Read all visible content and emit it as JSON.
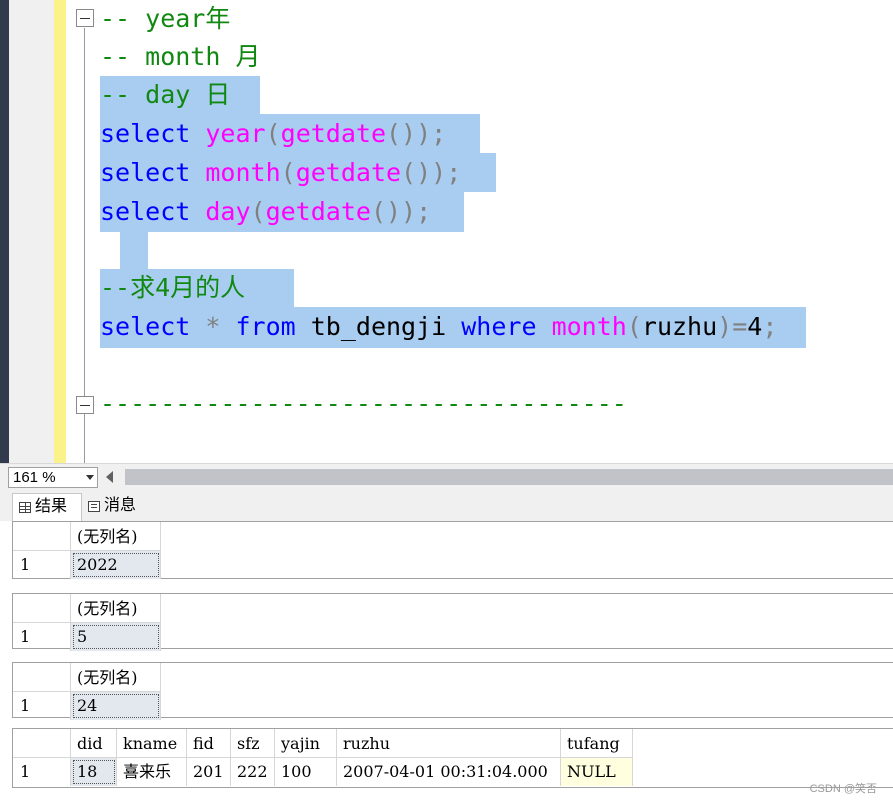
{
  "editor": {
    "lines": [
      {
        "tokens": [
          {
            "t": "-- year年",
            "c": "cm"
          }
        ]
      },
      {
        "tokens": [
          {
            "t": "-- month 月",
            "c": "cm"
          }
        ]
      },
      {
        "tokens": [
          {
            "t": "-- day 日",
            "c": "cm"
          }
        ]
      },
      {
        "tokens": [
          {
            "t": "select ",
            "c": "kw"
          },
          {
            "t": "year",
            "c": "fn"
          },
          {
            "t": "(",
            "c": "pn"
          },
          {
            "t": "getdate",
            "c": "fn"
          },
          {
            "t": "());",
            "c": "pn"
          }
        ]
      },
      {
        "tokens": [
          {
            "t": "select ",
            "c": "kw"
          },
          {
            "t": "month",
            "c": "fn"
          },
          {
            "t": "(",
            "c": "pn"
          },
          {
            "t": "getdate",
            "c": "fn"
          },
          {
            "t": "());",
            "c": "pn"
          }
        ]
      },
      {
        "tokens": [
          {
            "t": "select ",
            "c": "kw"
          },
          {
            "t": "day",
            "c": "fn"
          },
          {
            "t": "(",
            "c": "pn"
          },
          {
            "t": "getdate",
            "c": "fn"
          },
          {
            "t": "());",
            "c": "pn"
          }
        ]
      },
      {
        "tokens": []
      },
      {
        "tokens": [
          {
            "t": "--求4月的人",
            "c": "cm"
          }
        ]
      },
      {
        "tokens": [
          {
            "t": "select ",
            "c": "kw"
          },
          {
            "t": "* ",
            "c": "pn"
          },
          {
            "t": "from ",
            "c": "kw"
          },
          {
            "t": "tb_dengji ",
            "c": "tx"
          },
          {
            "t": "where ",
            "c": "kw"
          },
          {
            "t": "month",
            "c": "fn"
          },
          {
            "t": "(",
            "c": "pn"
          },
          {
            "t": "ruzhu",
            "c": "tx"
          },
          {
            "t": ")",
            "c": "pn"
          },
          {
            "t": "=",
            "c": "pn"
          },
          {
            "t": "4",
            "c": "tx"
          },
          {
            "t": ";",
            "c": "pn"
          }
        ]
      },
      {
        "tokens": []
      },
      {
        "tokens": [
          {
            "t": "-----------------------------------",
            "c": "cm"
          }
        ]
      }
    ]
  },
  "zoom": {
    "value": "161 %"
  },
  "results_tabs": {
    "results_label": "结果",
    "messages_label": "消息"
  },
  "grids": [
    {
      "columns": [
        "(无列名)"
      ],
      "rows": [
        {
          "num": "1",
          "cells": [
            "2022"
          ]
        }
      ]
    },
    {
      "columns": [
        "(无列名)"
      ],
      "rows": [
        {
          "num": "1",
          "cells": [
            "5"
          ]
        }
      ]
    },
    {
      "columns": [
        "(无列名)"
      ],
      "rows": [
        {
          "num": "1",
          "cells": [
            "24"
          ]
        }
      ]
    },
    {
      "columns": [
        "did",
        "kname",
        "fid",
        "sfz",
        "yajin",
        "ruzhu",
        "tufang"
      ],
      "rows": [
        {
          "num": "1",
          "cells": [
            "18",
            "喜来乐",
            "201",
            "222",
            "100",
            "2007-04-01 00:31:04.000",
            "NULL"
          ]
        }
      ]
    }
  ],
  "watermark": "CSDN @笑否"
}
